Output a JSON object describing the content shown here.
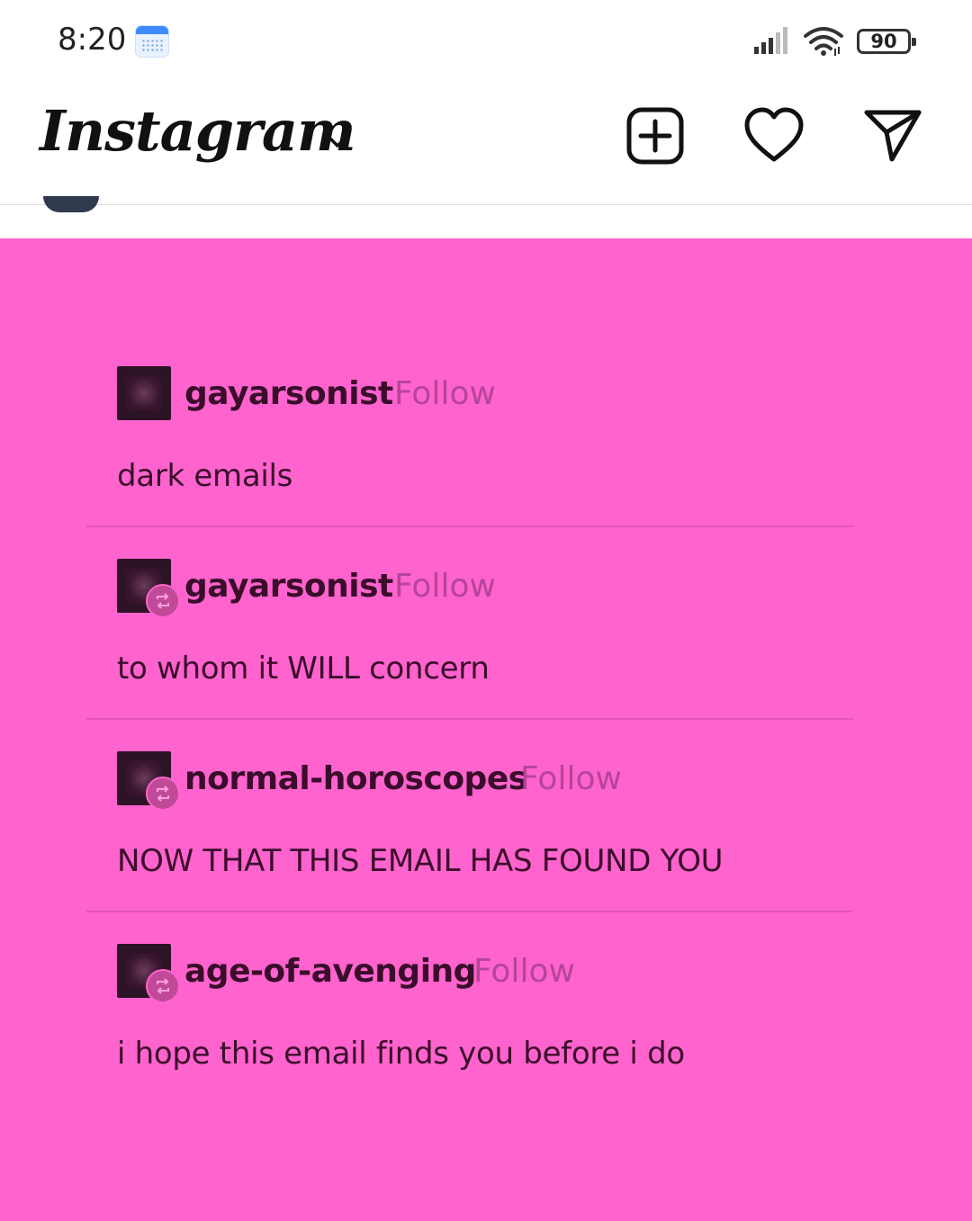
{
  "status_bar": {
    "time": "8:20",
    "battery": "90",
    "calendar_icon": "calendar-icon",
    "signal_icon": "signal-icon",
    "wifi_icon": "wifi-icon"
  },
  "header": {
    "title": "Instagram",
    "icons": [
      "chevron-down-icon",
      "add-post-icon",
      "heart-icon",
      "send-icon"
    ]
  },
  "post": {
    "background": "#ff63cd",
    "entries": [
      {
        "username": "gayarsonist",
        "follow": "Follow",
        "text": "dark emails",
        "reblog": false
      },
      {
        "username": "gayarsonist",
        "follow": "Follow",
        "text": "to whom it WILL concern",
        "reblog": true
      },
      {
        "username": "normal-horoscopes",
        "follow": "Follow",
        "text": "NOW THAT THIS EMAIL HAS FOUND YOU",
        "reblog": true
      },
      {
        "username": "age-of-avenging",
        "follow": "Follow",
        "text": "i hope this email finds you before i do",
        "reblog": true
      }
    ]
  }
}
